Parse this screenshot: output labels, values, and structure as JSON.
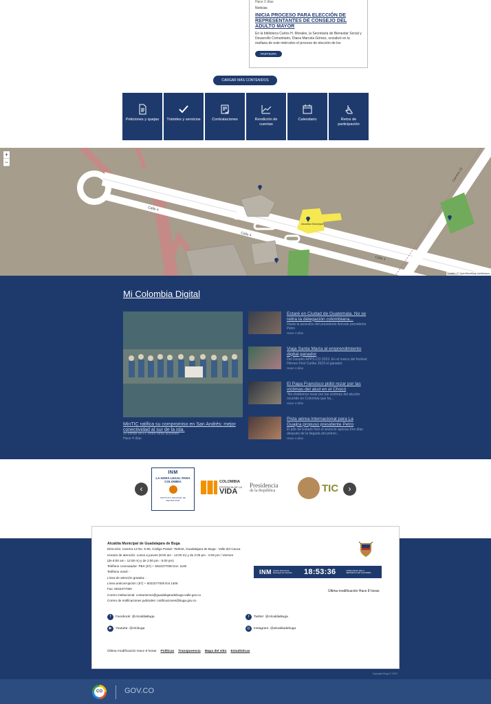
{
  "news": {
    "date": "Hace 2 días",
    "category": "Noticias",
    "title": "INICIA PROCESO PARA ELECCIÓN DE REPRESENTANTES DE CONSEJO DEL ADULTO MAYOR",
    "text": "En la biblioteca Carlos H. Morales, la Secretaría de Bienestar Social y Desarrollo Comunitario, Diana Marcela Gómez, socializó en la mañana de este miércoles el proceso de elección de los",
    "cta": "PARTICIPA"
  },
  "load_more": "CARGAR MÁS CONTENIDOS",
  "quick_links": [
    {
      "label": "Peticiones y quejas",
      "icon": "document-icon"
    },
    {
      "label": "Trámites y servicios",
      "icon": "check-icon"
    },
    {
      "label": "Contrataciones",
      "icon": "contract-icon"
    },
    {
      "label": "Rendición de cuentas",
      "icon": "chart-icon"
    },
    {
      "label": "Calendario",
      "icon": "calendar-icon"
    },
    {
      "label": "Retos de participación",
      "icon": "hand-icon"
    }
  ],
  "map": {
    "zoom_in": "+",
    "zoom_out": "−",
    "attribution": "Leaflet | © OpenStreetMap contributors",
    "labels": {
      "street1": "Calle 4",
      "street2": "Calle 4",
      "street3": "Calle 4",
      "carrera": "Carrera 15",
      "poi": "Alcaldía Municipal"
    }
  },
  "mcd": {
    "title": "Mi Colombia Digital",
    "featured": {
      "title": "MinTIC ratifica su compromiso en San Andrés: mejor conectividad al sur de la isla.",
      "desc": "30 zonas Wi-Fi, entre otras acciones",
      "time": "Hace 4 días"
    },
    "items": [
      {
        "title": "Estaré en Ciudad de Guatemala. No se retira la delegación colombiana...",
        "desc": "Hasta la posesión del presidente Arévalo presidente Petro",
        "time": "Hace 4 días"
      },
      {
        "title": "Viaja Santa María al emprendimiento digital ganador",
        "desc": "Del Desafío APPS.CO 2023. En el marco del festival Héroes Fest Caribe 2023 el ganador",
        "time": "Hace 4 días"
      },
      {
        "title": "El Papa Francisco pidió rezar por las víctimas del alud en el Chocó",
        "desc": "\"No olvidemos rezar por las víctimas del aluvión ocurrido en Colombia que ha...",
        "time": "Hace 4 días"
      },
      {
        "title": "Pista aérea internacional para La Guajira propuso presidente Petro",
        "desc": "El jefe de Estado hizo el anuncio apenas tres días después de la llegada del primer...",
        "time": "Hace 4 días"
      }
    ]
  },
  "logos": {
    "inm_name": "INM",
    "inm_hora": "LA HORA LEGAL PARA COLOMBIA",
    "inm_foot": "INSTITUTO NACIONAL DE METROLOGÍA",
    "colombia_t1": "COLOMBIA",
    "colombia_t2": "POTENCIA DE LA",
    "colombia_t3": "VIDA",
    "presidencia_1": "Presidencia",
    "presidencia_2": "de la República",
    "tic": "TIC",
    "prev": "‹",
    "next": "›"
  },
  "footer": {
    "org": "Alcaldía Municipal de Guadalajara de Buga",
    "lines": [
      "Dirección: Carrera 13 No. 5-50, Código Postal: 763042, Guadalajara de Buga - Valle del Cauca",
      "Horario de atención: Lunes a jueves (8:00 am - 12:00 m) y de 2:00 pm - 6:00 pm / Viernes",
      "(de 8:00 am - 12:00 m) y de 2:00 pm - 5:00 pm)",
      "Teléfono conmutador: PBX (57) + 6022377000 Ext. 1100",
      "Teléfono móvil: -",
      "Línea de atención gratuita: -",
      "Línea anticorrupción: (57) + 6022377000 Ext 1406",
      "Fax: 6022377000",
      "Correo institucional: contactenos@guadalajaradebuga-valle.gov.co",
      "Correo de notificaciones judiciales: notificaciones@buga.gov.co"
    ],
    "clock_inm": "INM",
    "clock_small": "Instituto Nacional de Metrología de Colombia",
    "clock_time": "18:53:36",
    "clock_small2": "HORA LEGAL DE LA REPÚBLICA DE COLOMBIA",
    "last_modified": "Última modificación Hace 8 horas",
    "social": {
      "facebook": "Facebook: @AlcaldiaBuga",
      "twitter": "Twitter: @AlcaldiaBuga",
      "youtube": "Youtube: @Alcbuga",
      "instagram": "Instagram: @alcaldiadebuga"
    },
    "bottom_mod": "Última modificación Hace 8 horas",
    "links": [
      "Políticas",
      "Transparencia",
      "Mapa del sitio",
      "Estadísticas"
    ],
    "copyright": "Copyright Buga © 2023"
  },
  "gov": {
    "co": "CO",
    "text": "GOV.CO"
  },
  "colors": {
    "primary": "#1e3a6d",
    "gov_bar": "#2c4c80"
  }
}
